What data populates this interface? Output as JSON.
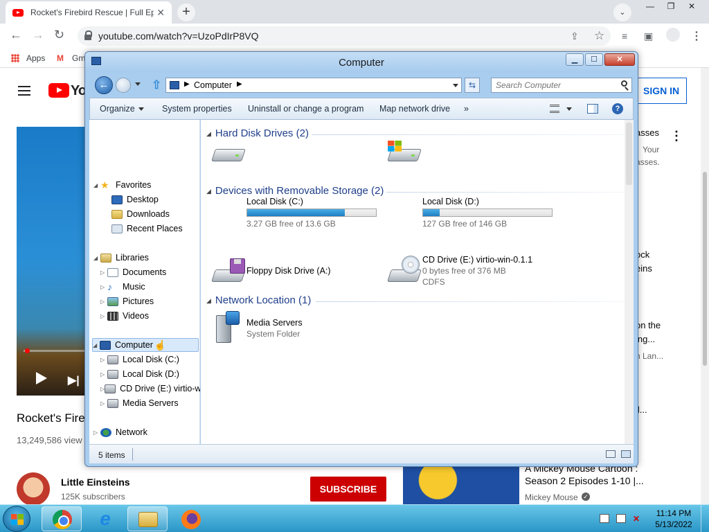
{
  "browser": {
    "tab_title": "Rocket's Firebird Rescue | Full Episode",
    "tab_close": "✕",
    "new_tab": "+",
    "url": "youtube.com/watch?v=UzoPdIrP8VQ",
    "bookmarks": {
      "apps": "Apps",
      "gmail": "Gm"
    },
    "window_controls": {
      "minimize": "—",
      "restore": "❐",
      "close": "✕"
    }
  },
  "youtube": {
    "logo_text": "Yo",
    "sign_in": "SIGN IN",
    "video_title": "Rocket's Fire",
    "views": "13,249,586 view",
    "channel_name": "Little Einsteins",
    "subscribers": "125K subscribers",
    "subscribe": "SUBSCRIBE",
    "recommendations": {
      "rec1_line1": "asses",
      "rec1_line2": "Your",
      "rec1_line3": "asses.",
      "rec2_line1": "ock",
      "rec2_line2": "eins",
      "rec3_line1": "on the",
      "rec3_line2": "ing...",
      "rec3_line3": "n Lan...",
      "rec4_line1": "ll...",
      "rec5_line1": "A Mickey Mouse Cartoon :",
      "rec5_line2": "Season 2 Episodes 1-10 |...",
      "rec5_channel": "Mickey Mouse"
    }
  },
  "explorer": {
    "title": "Computer",
    "address": "Computer",
    "search_placeholder": "Search Computer",
    "commands": {
      "organize": "Organize",
      "system_properties": "System properties",
      "uninstall": "Uninstall or change a program",
      "map_drive": "Map network drive",
      "more": "»"
    },
    "nav": {
      "favorites": "Favorites",
      "desktop": "Desktop",
      "downloads": "Downloads",
      "recent_places": "Recent Places",
      "libraries": "Libraries",
      "documents": "Documents",
      "music": "Music",
      "pictures": "Pictures",
      "videos": "Videos",
      "computer": "Computer",
      "local_c": "Local Disk (C:)",
      "local_d": "Local Disk (D:)",
      "cd_drive": "CD Drive (E:) virtio-w",
      "media_servers": "Media Servers",
      "network": "Network"
    },
    "groups": {
      "hdd": "Hard Disk Drives (2)",
      "removable": "Devices with Removable Storage (2)",
      "network": "Network Location (1)"
    },
    "items": {
      "c_name": "Local Disk (C:)",
      "c_free": "3.27 GB free of 13.6 GB",
      "c_used_fraction": 0.76,
      "d_name": "Local Disk (D:)",
      "d_free": "127 GB free of 146 GB",
      "d_used_fraction": 0.13,
      "floppy_name": "Floppy Disk Drive (A:)",
      "cd_name": "CD Drive (E:) virtio-win-0.1.1",
      "cd_free": "0 bytes free of 376 MB",
      "cd_fs": "CDFS",
      "ms_name": "Media Servers",
      "ms_type": "System Folder"
    },
    "status": "5 items"
  },
  "taskbar": {
    "time": "11:14 PM",
    "date": "5/13/2022"
  }
}
